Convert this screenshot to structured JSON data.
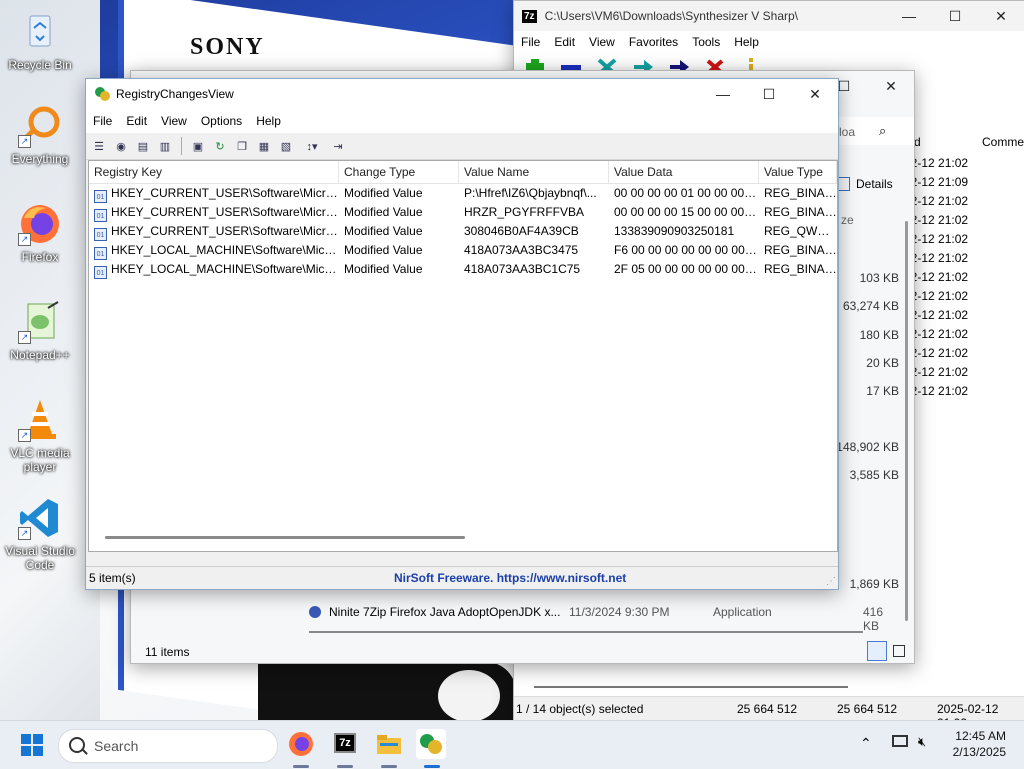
{
  "desktop": {
    "wallpaper_brand": "SONY",
    "icons": [
      {
        "label": "Recycle Bin",
        "icon": "recycle-bin-icon"
      },
      {
        "label": "Everything",
        "icon": "everything-search-icon"
      },
      {
        "label": "Firefox",
        "icon": "firefox-icon"
      },
      {
        "label": "Notepad++",
        "icon": "notepad-plus-plus-icon"
      },
      {
        "label": "VLC media player",
        "icon": "vlc-icon"
      },
      {
        "label": "Visual Studio Code",
        "icon": "vscode-icon"
      }
    ]
  },
  "sevenzip": {
    "logo": "7z",
    "title": "C:\\Users\\VM6\\Downloads\\Synthesizer V Sharp\\",
    "menu": [
      "File",
      "Edit",
      "View",
      "Favorites",
      "Tools",
      "Help"
    ],
    "column_header_date": "d",
    "column_header_comment": "Comme",
    "dates": [
      "02-12 21:02",
      "02-12 21:09",
      "02-12 21:02",
      "02-12 21:02",
      "02-12 21:02",
      "02-12 21:02",
      "02-12 21:02",
      "02-12 21:02",
      "02-12 21:02",
      "02-12 21:02",
      "02-12 21:02",
      "02-12 21:02",
      "02-12 21:02"
    ],
    "status": {
      "selection": "1 / 14 object(s) selected",
      "size": "25 664 512",
      "packed": "25 664 512",
      "modified": "2025-02-12 21:02"
    }
  },
  "explorer": {
    "search_fragment": "loa",
    "view_label": "Details",
    "size_header_fragment": "ze",
    "sizes": [
      "103 KB",
      "63,274 KB",
      "180 KB",
      "20 KB",
      "17 KB",
      "148,902 KB",
      "3,585 KB",
      "1,869 KB"
    ],
    "visible_file": {
      "name": "Ninite 7Zip Firefox Java AdoptOpenJDK x...",
      "date": "11/3/2024 9:30 PM",
      "type": "Application",
      "size": "416 KB"
    },
    "item_count": "11 items"
  },
  "registry": {
    "title": "RegistryChangesView",
    "menu": [
      "File",
      "Edit",
      "View",
      "Options",
      "Help"
    ],
    "columns": [
      "Registry Key",
      "Change Type",
      "Value Name",
      "Value Data",
      "Value Type"
    ],
    "rows": [
      [
        "HKEY_CURRENT_USER\\Software\\Microso...",
        "Modified Value",
        "P:\\Hfref\\IZ6\\Qbjaybnqf\\...",
        "00 00 00 00 01 00 00 00 0...",
        "REG_BINARY"
      ],
      [
        "HKEY_CURRENT_USER\\Software\\Microso...",
        "Modified Value",
        "HRZR_PGYFRFFVBA",
        "00 00 00 00 15 00 00 00 4...",
        "REG_BINARY"
      ],
      [
        "HKEY_CURRENT_USER\\Software\\Microso...",
        "Modified Value",
        "308046B0AF4A39CB",
        "133839090903250181",
        "REG_QWORD"
      ],
      [
        "HKEY_LOCAL_MACHINE\\Software\\Micro...",
        "Modified Value",
        "418A073AA3BC3475",
        "F6 00 00 00 00 00 00 00 0...",
        "REG_BINARY"
      ],
      [
        "HKEY_LOCAL_MACHINE\\Software\\Micro...",
        "Modified Value",
        "418A073AA3BC1C75",
        "2F 05 00 00 00 00 00 00 0...",
        "REG_BINARY"
      ]
    ],
    "status_count": "5 item(s)",
    "status_link": "NirSoft Freeware. https://www.nirsoft.net"
  },
  "taskbar": {
    "search_placeholder": "Search",
    "apps": [
      "firefox-icon",
      "7zip-icon",
      "file-explorer-icon",
      "registry-changes-view-icon"
    ],
    "time": "12:45 AM",
    "date": "2/13/2025"
  }
}
